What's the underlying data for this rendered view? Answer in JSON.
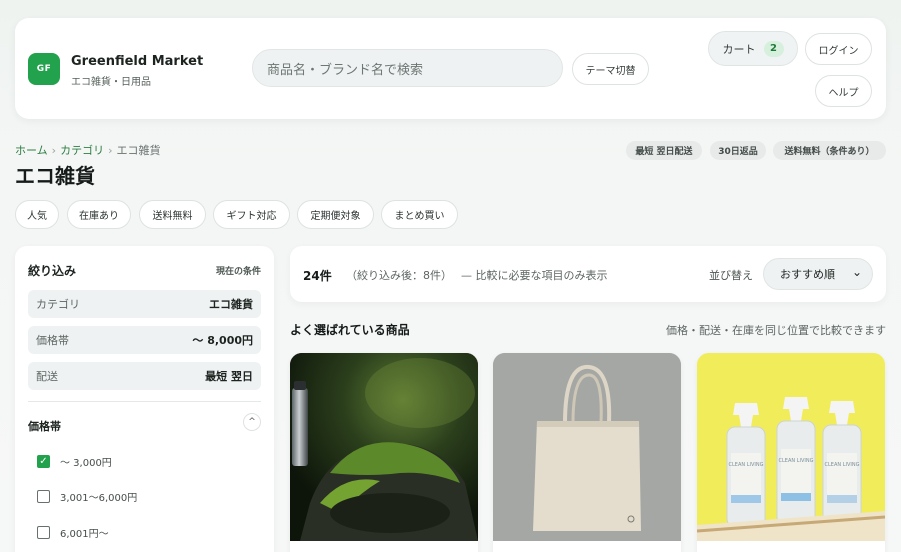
{
  "header": {
    "logo_text": "GF",
    "brand_name": "Greenfield Market",
    "brand_sub": "エコ雑貨・日用品",
    "search_placeholder": "商品名・ブランド名で検索",
    "theme_toggle": "テーマ切替",
    "cart_label": "カート",
    "cart_count": "2",
    "login": "ログイン",
    "help": "ヘルプ"
  },
  "breadcrumb": {
    "home": "ホーム",
    "category": "カテゴリ",
    "current": "エコ雑貨"
  },
  "tags": [
    "最短 翌日配送",
    "30日返品",
    "送料無料（条件あり）"
  ],
  "page_title": "エコ雑貨",
  "chips": [
    "人気",
    "在庫あり",
    "送料無料",
    "ギフト対応",
    "定期便対象",
    "まとめ買い"
  ],
  "sidebar": {
    "title": "絞り込み",
    "current_label": "現在の条件",
    "conditions": [
      {
        "key": "カテゴリ",
        "value": "エコ雑貨"
      },
      {
        "key": "価格帯",
        "value": "〜 8,000円"
      },
      {
        "key": "配送",
        "value": "最短 翌日"
      }
    ],
    "price_section": "価格帯",
    "toggle": "^",
    "price_options": [
      {
        "label": "〜 3,000円",
        "checked": true
      },
      {
        "label": "3,001〜6,000円",
        "checked": false
      },
      {
        "label": "6,001円〜",
        "checked": false
      }
    ]
  },
  "results": {
    "count": "24件",
    "filtered": "（絞り込み後：8件）",
    "note": "— 比較に必要な項目のみ表示",
    "sort_label": "並び替え",
    "sort_value": "おすすめ順",
    "sort_chevron": "⌄"
  },
  "section": {
    "title": "よく選ばれている商品",
    "note": "価格・配送・在庫を同じ位置で比較できます"
  },
  "products": [
    {
      "image": "bottle-on-moss"
    },
    {
      "image": "canvas-tote-bag"
    },
    {
      "image": "spray-bottles"
    }
  ],
  "spray_label": "CLEAN LIVING",
  "colors": {
    "accent": "#22a24c",
    "accent_text": "#2e7d45"
  }
}
